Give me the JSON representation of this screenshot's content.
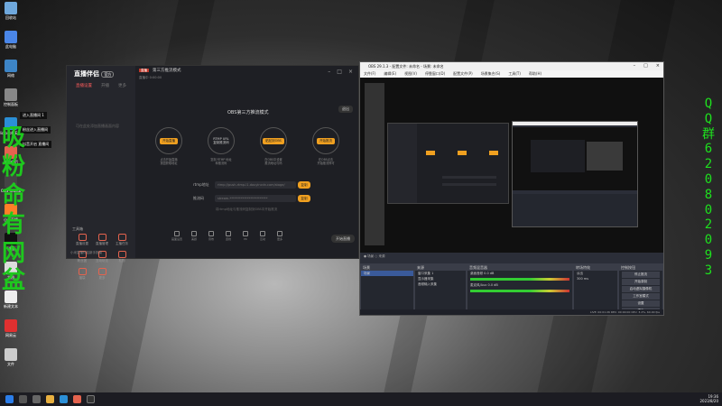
{
  "desktop": {
    "icons": [
      {
        "label": "回收站"
      },
      {
        "label": "此电脑"
      },
      {
        "label": "网络"
      },
      {
        "label": "控制面板"
      },
      {
        "label": "Microsoft Edge"
      },
      {
        "label": "直播伴侣"
      },
      {
        "label": "OBS Studio"
      },
      {
        "label": "小米直播"
      },
      {
        "label": "抖音"
      },
      {
        "label": "文档"
      },
      {
        "label": "新建文本"
      },
      {
        "label": "网易云"
      },
      {
        "label": "文件"
      }
    ],
    "overlay_texts": [
      "进入直播间 1",
      "粉丝进入直播间",
      "抖音开启 直播间"
    ],
    "handwriting": [
      "吸",
      "粉",
      "命",
      "有",
      "网",
      "盆"
    ],
    "qq_chars": [
      "Q",
      "Q",
      "群",
      "6",
      "2",
      "0",
      "8",
      "0",
      "2",
      "0",
      "9",
      "3"
    ]
  },
  "douyin": {
    "app_name": "直播伴侣",
    "version_badge": "官方",
    "side_tabs": [
      "直播设置",
      "开播",
      "更多"
    ],
    "empty_hint": "可在此处添加直播画面内容",
    "tools_title": "工具箱",
    "tools": [
      "直播设置",
      "直播管理",
      "主播任务",
      "粉丝团",
      "互动玩法",
      "礼物",
      "福袋",
      "更多"
    ],
    "footer": "小米直播伴侣新手指南",
    "header_title": "第三方推流模式",
    "header_tag": "直播",
    "header_meta": "直播中  0:00:00",
    "lock_btn": "退出",
    "mode_title": "OBS第三方推流模式",
    "steps": [
      {
        "label": "开始直播",
        "desc": "点击开始直播\n按钮获取地址"
      },
      {
        "label": "RTMP URL\n复制推流码",
        "desc": "复制 RTMP 地址\n和推流码"
      },
      {
        "label": "粘贴到OBS",
        "desc": "在OBS中设置\n推流地址与码"
      },
      {
        "label": "开始推流",
        "desc": "在OBS点击\n开始推流即可"
      }
    ],
    "rows": [
      {
        "label": "rtmp地址",
        "value": "rtmp://push-rtmp-l1.douyincdn.com/stage/",
        "btn": "复制"
      },
      {
        "label": "推流码",
        "value": "stream-************************",
        "btn": "复制"
      }
    ],
    "note": "将rtmp地址与推流码复制到OBS中开始推流",
    "bottom_tools": [
      "画面设置",
      "美颜",
      "音效",
      "连线",
      "PK",
      "互动",
      "更多"
    ],
    "start_button": "开始直播"
  },
  "obs": {
    "title": "OBS 29.1.3 - 配置文件: 未命名 - 场景: 未命名",
    "menu": [
      "文件(F)",
      "编辑(E)",
      "视图(V)",
      "停靠窗口(D)",
      "配置文件(P)",
      "场景集合(S)",
      "工具(T)",
      "帮助(H)"
    ],
    "scenes_title": "场景",
    "scenes": [
      "场景"
    ],
    "sources_title": "来源",
    "sources": [
      "窗口采集 1",
      "显示器采集",
      "音频输入采集"
    ],
    "mixer_title": "音频混音器",
    "mixer": [
      {
        "name": "桌面音频",
        "db": "0.0 dB"
      },
      {
        "name": "麦克风/Aux",
        "db": "0.0 dB"
      }
    ],
    "transitions_title": "转场特效",
    "transition_value": "淡出",
    "duration": "300 ms",
    "controls_title": "控制按钮",
    "controls": [
      "停止推流",
      "开始录制",
      "启动虚拟摄像机",
      "工作室模式",
      "设置",
      "退出"
    ],
    "status": "LIVE: 00:01:26   REC: 00:00:00   CPU: 3.2%, 60.00 fps"
  },
  "taskbar": {
    "time": "19:36",
    "date": "2023/8/20"
  }
}
